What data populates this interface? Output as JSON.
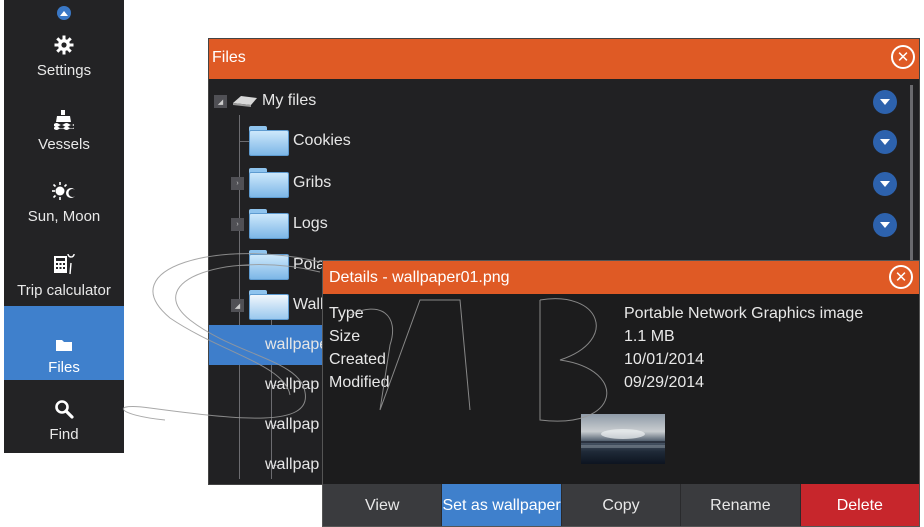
{
  "sidebar": {
    "items": [
      {
        "label": "Settings",
        "icon": "gear-icon"
      },
      {
        "label": "Vessels",
        "icon": "ship-icon"
      },
      {
        "label": "Sun, Moon",
        "icon": "sun-moon-icon"
      },
      {
        "label": "Trip calculator",
        "icon": "calculator-icon"
      },
      {
        "label": "Files",
        "icon": "folder-icon"
      },
      {
        "label": "Find",
        "icon": "magnifier-icon"
      }
    ],
    "active": "Files"
  },
  "files_window": {
    "title": "Files",
    "close_glyph": "✕",
    "tree": [
      {
        "label": "My files"
      },
      {
        "label": "Cookies"
      },
      {
        "label": "Gribs"
      },
      {
        "label": "Logs"
      },
      {
        "label": "Pola"
      },
      {
        "label": "Wall"
      },
      {
        "label": "wallpaper"
      },
      {
        "label": "wallpap"
      },
      {
        "label": "wallpap"
      },
      {
        "label": "wallpap"
      }
    ]
  },
  "details": {
    "title": "Details - wallpaper01.png",
    "close_glyph": "✕",
    "fields": [
      {
        "name": "Type",
        "value": "Portable Network Graphics image"
      },
      {
        "name": "Size",
        "value": "1.1 MB"
      },
      {
        "name": "Created",
        "value": "10/01/2014"
      },
      {
        "name": "Modified",
        "value": "09/29/2014"
      }
    ],
    "buttons": {
      "view": "View",
      "set_wallpaper": "Set as wallpaper",
      "copy": "Copy",
      "rename": "Rename",
      "delete": "Delete"
    }
  },
  "colors": {
    "title_bar": "#df5a25",
    "accent_blue": "#3f80cc",
    "delete_red": "#c7262c",
    "sidebar_bg": "#232325"
  }
}
